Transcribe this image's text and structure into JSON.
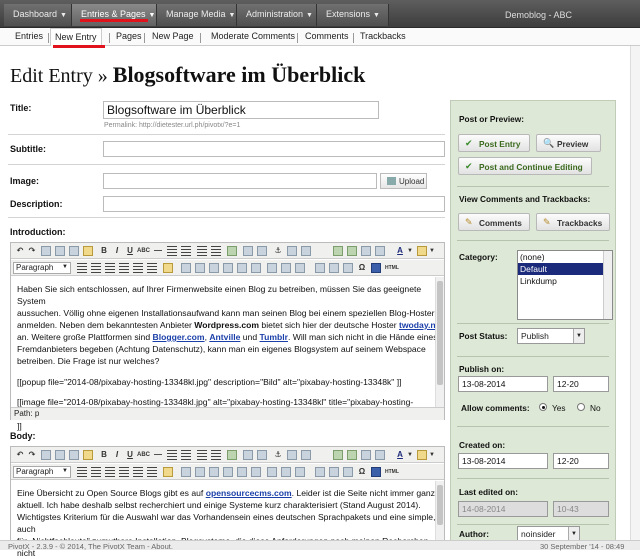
{
  "topnav": {
    "items": [
      "Dashboard",
      "Entries & Pages",
      "Manage Media",
      "Administration",
      "Extensions"
    ],
    "site_name": "Demoblog - ABC"
  },
  "subnav": {
    "items": [
      "Entries",
      "New Entry",
      "Pages",
      "New Page",
      "Moderate Comments",
      "Comments",
      "Trackbacks"
    ]
  },
  "page": {
    "heading": "Edit Entry",
    "heading_sep": " » ",
    "heading_title": "Blogsoftware im Überblick"
  },
  "form": {
    "title_label": "Title:",
    "title_value": "Blogsoftware im Überblick",
    "permalink": "Permalink: http://dietester.url.ph/pivotx/?e=1",
    "subtitle_label": "Subtitle:",
    "image_label": "Image:",
    "upload_label": "Upload",
    "description_label": "Description:",
    "introduction_label": "Introduction:",
    "body_label": "Body:",
    "paragraph_format": "Paragraph",
    "path_label": "Path: p"
  },
  "intro": {
    "p1_a": "Haben Sie sich entschlossen, auf Ihrer Firmenwebsite einen Blog zu betreiben, müssen Sie das geeignete System",
    "p1_b": "aussuchen. Völlig ohne eigenen Installationsaufwand kann man seinen Blog bei einem speziellen Blog-Hoster",
    "p1_c1": "anmelden. Neben dem bekanntesten Anbieter ",
    "p1_c_bold": "Wordpress.com",
    "p1_c2": " bietet sich hier der deutsche Hoster ",
    "p1_c_link": "twoday.net",
    "p1_d1": "an. Weitere große Plattformen sind ",
    "p1_d_l1": "Blogger.com",
    "p1_d_sep1": ", ",
    "p1_d_l2": "Antville",
    "p1_d_and": " und ",
    "p1_d_l3": "Tumblr",
    "p1_d2": ". Will man sich nicht in die Hände eines",
    "p1_e": "Fremdanbieters begeben (Achtung Datenschutz), kann man ein eigenes Blogsystem auf seinem Webspace",
    "p1_f": "betreiben. Die Frage ist nur welches?",
    "p2": "[[popup file=\"2014-08/pixabay-hosting-13348kl.jpg\" description=\"Bild\" alt=\"pixabay-hosting-13348k\" ]]",
    "p3": "[[image file=\"2014-08/pixabay-hosting-13348kl.jpg\" alt=\"pixabay-hosting-13348kl\" title=\"pixabay-hosting-13348kl\"",
    "p3b": "]]"
  },
  "body_text": {
    "l1a": "Eine Übersicht zu Open Source Blogs gibt es auf ",
    "l1_link": "opensourcecms.com",
    "l1b": ". Leider ist die Seite nicht immer ganz",
    "l2": "aktuell. Ich habe deshalb selbst recherchiert und einige Systeme kurz charakterisiert (Stand August 2014).",
    "l3": "Wichtigstes Kriterium für die Auswahl war das Vorhandensein eines deutschen Sprachpakets und eine simple, auch",
    "l4": "für „Nichtfachleute\" zumutbare Installation. Blogsysteme, die diese Anforderungen nach meinen Recherchen nicht"
  },
  "sidebar": {
    "post_preview_label": "Post or Preview:",
    "post_entry": "Post Entry",
    "preview": "Preview",
    "post_continue": "Post and Continue Editing",
    "view_comments_label": "View Comments and Trackbacks:",
    "comments": "Comments",
    "trackbacks": "Trackbacks",
    "category_label": "Category:",
    "categories": [
      "(none)",
      "Default",
      "Linkdump"
    ],
    "selected_category": "Default",
    "post_status_label": "Post Status:",
    "post_status": "Publish",
    "publish_on_label": "Publish on:",
    "publish_date": "13-08-2014",
    "publish_time": "12-20",
    "allow_comments_label": "Allow comments:",
    "yes": "Yes",
    "no": "No",
    "created_on_label": "Created on:",
    "created_date": "13-08-2014",
    "created_time": "12-20",
    "last_edited_label": "Last edited on:",
    "edited_date": "14-08-2014",
    "edited_time": "10-43",
    "author_label": "Author:",
    "author": "noinsider"
  },
  "footer": {
    "left": "PivotX - 2.3.9  -  © 2014, The PivotX Team - About.",
    "right": "30 September '14 - 08:49"
  },
  "colors": {
    "accent_red": "#e0121b",
    "sidebar_bg": "#dde8d6",
    "link_blue": "#1a3fa8",
    "selection": "#1b2a7a"
  }
}
